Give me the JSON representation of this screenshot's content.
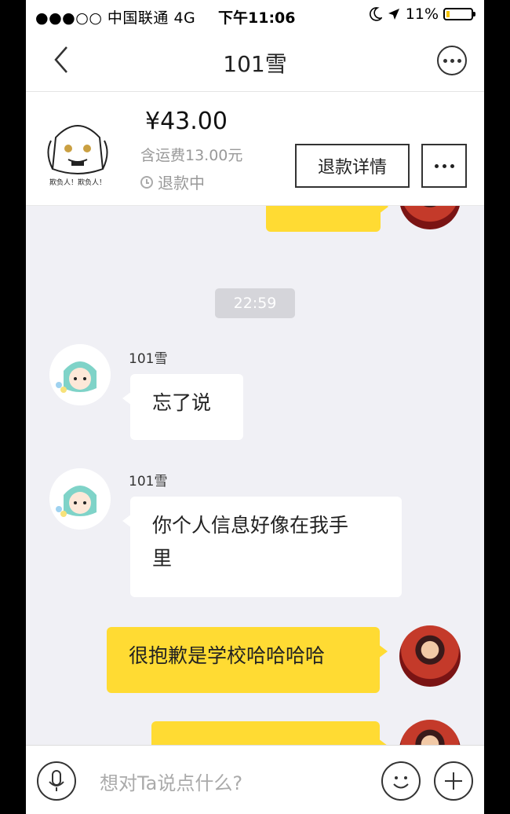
{
  "status_bar": {
    "carrier": "●●●○○ 中国联通  4G",
    "time": "下午11:06",
    "battery": "11%",
    "battery_level": 0.11
  },
  "nav": {
    "title": "101雪",
    "back_icon": "chevron-left-icon",
    "more_icon": "ellipsis-circle-icon"
  },
  "order": {
    "price": "¥43.00",
    "shipping": "含运费13.00元",
    "status": "退款中",
    "refund_button": "退款详情",
    "thumb_caption": "欺负人！欺负人！"
  },
  "chat": {
    "timestamp": "22:59",
    "messages": [
      {
        "from": "other",
        "sender": "101雪",
        "text": "忘了说"
      },
      {
        "from": "other",
        "sender": "101雪",
        "text_line1": "你个人信息好像在我手",
        "text_line2": "里"
      },
      {
        "from": "me",
        "text": "很抱歉是学校哈哈哈哈"
      }
    ]
  },
  "input": {
    "placeholder": "想对Ta说点什么?"
  }
}
